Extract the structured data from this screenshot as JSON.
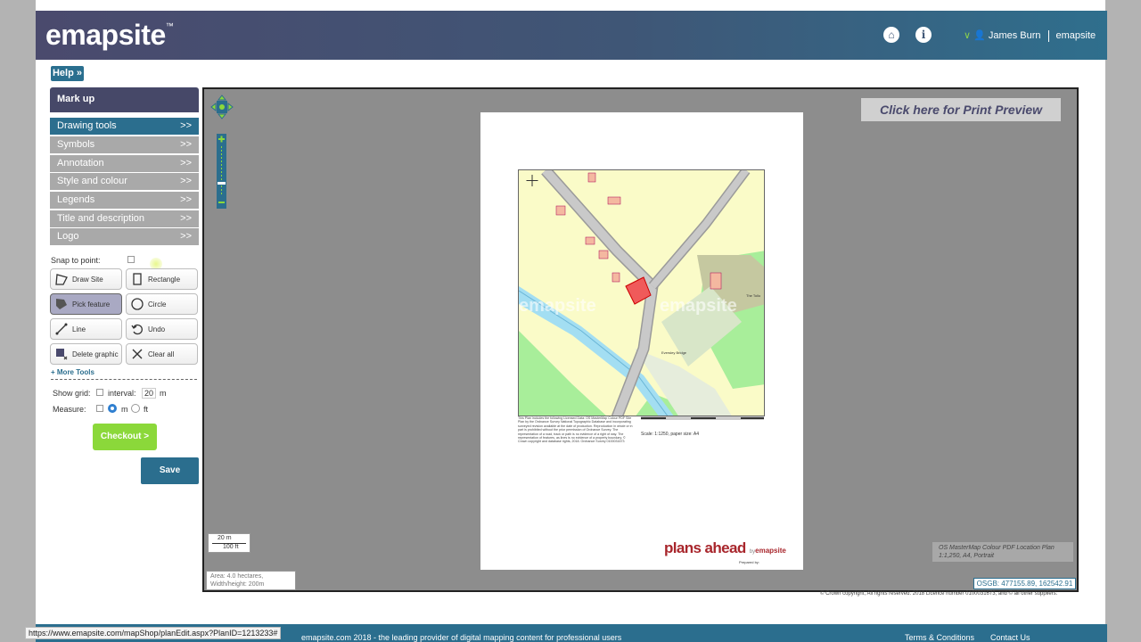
{
  "header": {
    "logo": "emapsite",
    "logo_tm": "™",
    "user_name": "James Burn",
    "brand": "emapsite"
  },
  "help": "Help »",
  "panel": {
    "title": "Mark up",
    "menu": [
      {
        "label": "Drawing tools",
        "arrow": ">>"
      },
      {
        "label": "Symbols",
        "arrow": ">>"
      },
      {
        "label": "Annotation",
        "arrow": ">>"
      },
      {
        "label": "Style and colour",
        "arrow": ">>"
      },
      {
        "label": "Legends",
        "arrow": ">>"
      },
      {
        "label": "Title and description",
        "arrow": ">>"
      },
      {
        "label": "Logo",
        "arrow": ">>"
      }
    ],
    "snap_label": "Snap to point:",
    "tools": {
      "draw_site": "Draw Site",
      "rectangle": "Rectangle",
      "pick_feature": "Pick feature",
      "circle": "Circle",
      "line": "Line",
      "undo": "Undo",
      "delete_graphic": "Delete graphic",
      "clear_all": "Clear all"
    },
    "more_tools": "+ More Tools",
    "show_grid": "Show grid:",
    "interval_label": "interval:",
    "interval_value": "20",
    "interval_unit": "m",
    "measure": "Measure:",
    "unit_m": "m",
    "unit_ft": "ft",
    "checkout": "Checkout >",
    "save": "Save"
  },
  "map": {
    "print_preview": "Click here for Print Preview",
    "map_labels": {
      "watermark1": "emapsite",
      "watermark2": "emapsite",
      "bridge": "Eversley Bridge",
      "the_tollo": "The Tollo"
    },
    "legend_text": "This Plan includes the following Licensed Data: OS MasterMap Colour PDF Site Plan by the Ordnance Survey National Topographic Database and incorporating surveyed revision available at the date of production. Reproduction in whole or in part is prohibited without the prior permission of Ordnance Survey. The representation of a road, track or path is no evidence of a right of way. The representation of features, as lines is no evidence of a property boundary. © Crown copyright and database rights, 2018. Ordnance Survey 0100031673",
    "scale_text": "Scale: 1:1250, paper size: A4",
    "plans_ahead": "plans ahead",
    "by": "by",
    "plans_brand": "emapsite",
    "prepared_by": "Prepared by:",
    "scale_m": "20 m",
    "scale_ft": "100 ft",
    "area_line1": "Area: 4.0 hectares,",
    "area_line2": "Width/height: 200m",
    "plan_desc_line1": "OS MasterMap Colour PDF Location Plan",
    "plan_desc_line2": "1:1,250, A4, Portrait",
    "coords": "OSGB: 477155.89, 162542.91"
  },
  "copyright": "© Crown copyright, All rights reserved. 2018 Licence number 0100031673, and © all other suppliers.",
  "footer": {
    "text": "emapsite.com 2018 - the leading provider of digital mapping content for professional users",
    "terms": "Terms & Conditions",
    "contact": "Contact Us"
  },
  "status_url": "https://www.emapsite.com/mapShop/planEdit.aspx?PlanID=1213233#",
  "colors": {
    "header_dark": "#4a4a6d",
    "accent_teal": "#2b6e8e",
    "checkout_green": "#8bd83a",
    "brand_red": "#a8262c"
  }
}
